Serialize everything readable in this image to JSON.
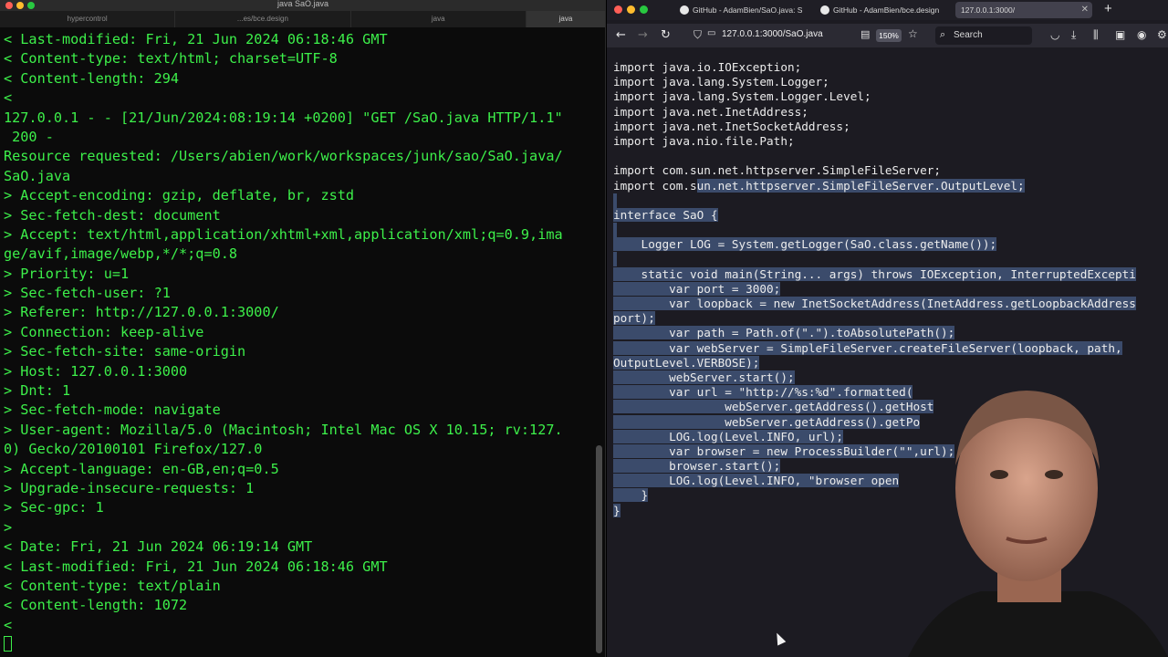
{
  "terminal": {
    "window_title": "java SaO.java",
    "tabs": [
      {
        "label": "hypercontrol"
      },
      {
        "label": "...es/bce.design"
      },
      {
        "label": "java"
      },
      {
        "label": "java"
      }
    ],
    "text_color": "#3df04a",
    "lines": [
      "< Last-modified: Fri, 21 Jun 2024 06:18:46 GMT",
      "< Content-type: text/html; charset=UTF-8",
      "< Content-length: 294",
      "<",
      "127.0.0.1 - - [21/Jun/2024:08:19:14 +0200] \"GET /SaO.java HTTP/1.1\"",
      " 200 -",
      "Resource requested: /Users/abien/work/workspaces/junk/sao/SaO.java/",
      "SaO.java",
      "> Accept-encoding: gzip, deflate, br, zstd",
      "> Sec-fetch-dest: document",
      "> Accept: text/html,application/xhtml+xml,application/xml;q=0.9,ima",
      "ge/avif,image/webp,*/*;q=0.8",
      "> Priority: u=1",
      "> Sec-fetch-user: ?1",
      "> Referer: http://127.0.0.1:3000/",
      "> Connection: keep-alive",
      "> Sec-fetch-site: same-origin",
      "> Host: 127.0.0.1:3000",
      "> Dnt: 1",
      "> Sec-fetch-mode: navigate",
      "> User-agent: Mozilla/5.0 (Macintosh; Intel Mac OS X 10.15; rv:127.",
      "0) Gecko/20100101 Firefox/127.0",
      "> Accept-language: en-GB,en;q=0.5",
      "> Upgrade-insecure-requests: 1",
      "> Sec-gpc: 1",
      ">",
      "< Date: Fri, 21 Jun 2024 06:19:14 GMT",
      "< Last-modified: Fri, 21 Jun 2024 06:18:46 GMT",
      "< Content-type: text/plain",
      "< Content-length: 1072",
      "<"
    ]
  },
  "browser": {
    "tabs": [
      {
        "label": "GitHub - AdamBien/SaO.java: S"
      },
      {
        "label": "GitHub - AdamBien/bce.design"
      },
      {
        "label": "127.0.0.1:3000/"
      }
    ],
    "url": "127.0.0.1:3000/SaO.java",
    "zoom": "150%",
    "search_placeholder": "Search",
    "selection_color": "#3b4b6b",
    "code_lines": [
      {
        "text": "import java.io.IOException;"
      },
      {
        "text": "import java.lang.System.Logger;"
      },
      {
        "text": "import java.lang.System.Logger.Level;"
      },
      {
        "text": "import java.net.InetAddress;"
      },
      {
        "text": "import java.net.InetSocketAddress;"
      },
      {
        "text": "import java.nio.file.Path;"
      },
      {
        "text": ""
      },
      {
        "text": "import com.sun.net.httpserver.SimpleFileServer;"
      },
      {
        "pre": "import com.s",
        "sel": "un.net.httpserver.SimpleFileServer.OutputLevel;"
      },
      {
        "sel": ""
      },
      {
        "sel": "interface SaO {"
      },
      {
        "sel": ""
      },
      {
        "sel": "    Logger LOG = System.getLogger(SaO.class.getName());"
      },
      {
        "sel": ""
      },
      {
        "sel": "    static void main(String... args) throws IOException, InterruptedExcepti"
      },
      {
        "sel": "        var port = 3000;"
      },
      {
        "sel": "        var loopback = new InetSocketAddress(InetAddress.getLoopbackAddress"
      },
      {
        "sel": "port);"
      },
      {
        "sel": "        var path = Path.of(\".\").toAbsolutePath();"
      },
      {
        "sel": "        var webServer = SimpleFileServer.createFileServer(loopback, path,"
      },
      {
        "sel": "OutputLevel.VERBOSE);"
      },
      {
        "sel": "        webServer.start();"
      },
      {
        "sel": "        var url = \"http://%s:%d\".formatted("
      },
      {
        "sel": "                webServer.getAddress().getHost"
      },
      {
        "sel": "                webServer.getAddress().getPo"
      },
      {
        "sel": "        LOG.log(Level.INFO, url);"
      },
      {
        "sel": "        var browser = new ProcessBuilder(\"",
        "post_sel": "\",url);"
      },
      {
        "sel": "        browser.start();"
      },
      {
        "sel": "        LOG.log(Level.INFO, \"browser open"
      },
      {
        "sel": "    }"
      },
      {
        "sel": "}"
      }
    ]
  }
}
